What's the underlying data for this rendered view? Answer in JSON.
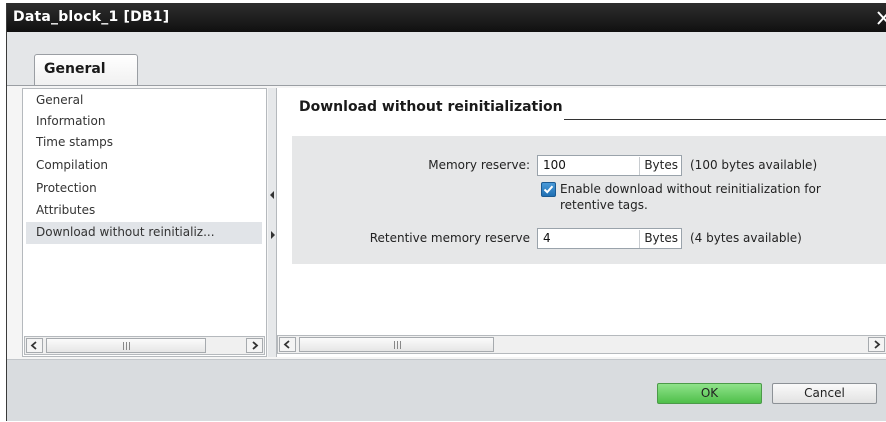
{
  "window": {
    "title": "Data_block_1 [DB1]",
    "close_glyph": "X"
  },
  "tabs": [
    {
      "label": "General",
      "active": true
    }
  ],
  "nav": {
    "items": [
      {
        "label": "General"
      },
      {
        "label": "Information"
      },
      {
        "label": "Time stamps"
      },
      {
        "label": "Compilation"
      },
      {
        "label": "Protection"
      },
      {
        "label": "Attributes"
      },
      {
        "label": "Download without reinitializ...",
        "selected": true
      }
    ]
  },
  "section": {
    "title": "Download without reinitialization"
  },
  "settings": {
    "memory_reserve": {
      "label": "Memory reserve:",
      "value": "100",
      "unit": "Bytes",
      "note": "(100 bytes available)"
    },
    "enable_download": {
      "checked": true,
      "line1": "Enable download without reinitialization for",
      "line2": "retentive tags."
    },
    "retentive_reserve": {
      "label": "Retentive memory reserve",
      "value": "4",
      "unit": "Bytes",
      "note": "(4 bytes available)"
    }
  },
  "buttons": {
    "ok": "OK",
    "cancel": "Cancel"
  },
  "colors": {
    "titlebar": "#1a1a1a",
    "ok_button": "#5fcf59",
    "checkbox": "#2a7fc4",
    "selected_row": "#e1e4e8"
  }
}
